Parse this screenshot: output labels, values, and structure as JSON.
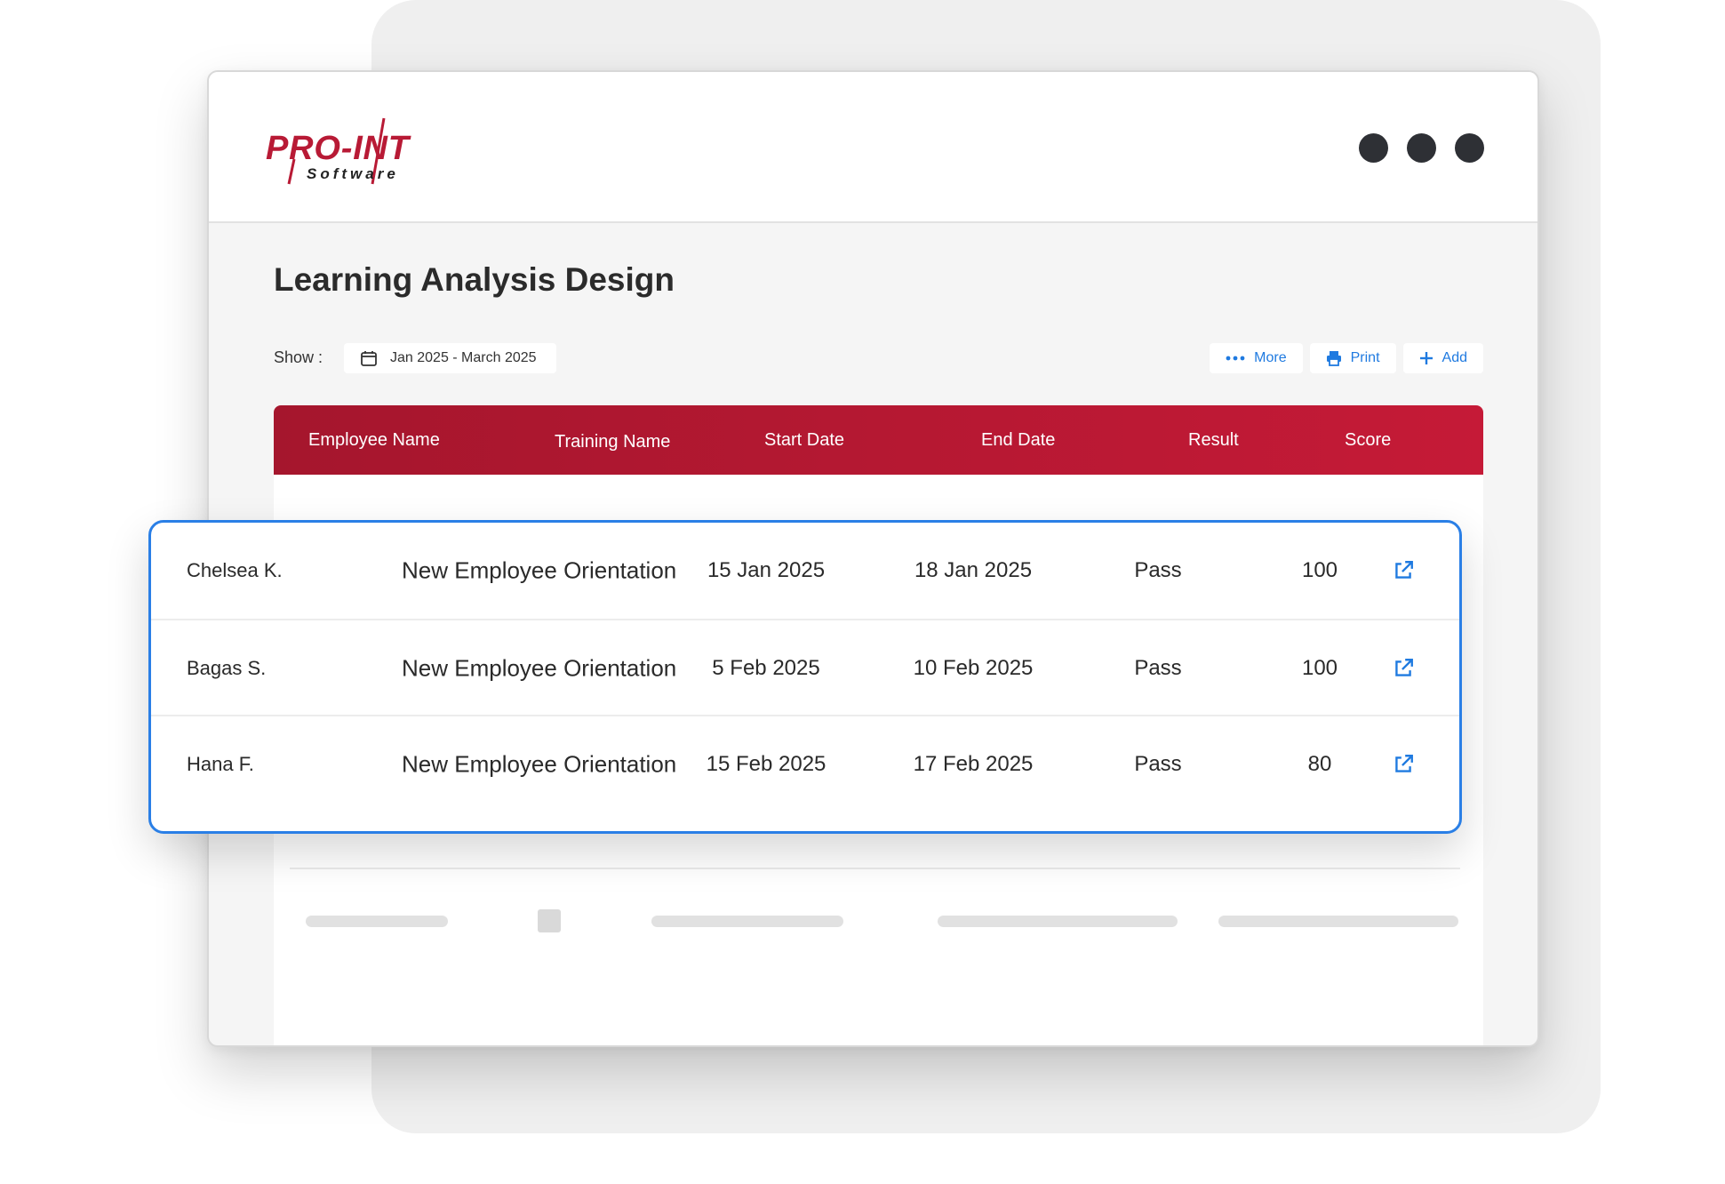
{
  "brand": {
    "logo_text": "PRO-INT",
    "logo_subtext": "Software",
    "color": "#b81a35"
  },
  "window_controls": [
    "dot",
    "dot",
    "dot"
  ],
  "page": {
    "title": "Learning Analysis Design"
  },
  "filter": {
    "show_label": "Show :",
    "date_range": "Jan 2025 - March 2025",
    "icon": "calendar-icon"
  },
  "actions": {
    "more": "More",
    "print": "Print",
    "add": "Add",
    "accent": "#1f7ae0"
  },
  "table": {
    "header_color": "#b81a35",
    "columns": [
      "Employee Name",
      "Training Name",
      "Start Date",
      "End Date",
      "Result",
      "Score"
    ],
    "rows": [
      {
        "employee": "Chelsea K.",
        "training": "New Employee Orientation",
        "start": "15 Jan 2025",
        "end": "18 Jan 2025",
        "result": "Pass",
        "score": "100",
        "icon": "external-link-icon"
      },
      {
        "employee": "Bagas S.",
        "training": "New Employee Orientation",
        "start": "5 Feb 2025",
        "end": "10 Feb 2025",
        "result": "Pass",
        "score": "100",
        "icon": "external-link-icon"
      },
      {
        "employee": "Hana F.",
        "training": "New Employee Orientation",
        "start": "15 Feb 2025",
        "end": "17 Feb 2025",
        "result": "Pass",
        "score": "80",
        "icon": "external-link-icon"
      }
    ]
  }
}
